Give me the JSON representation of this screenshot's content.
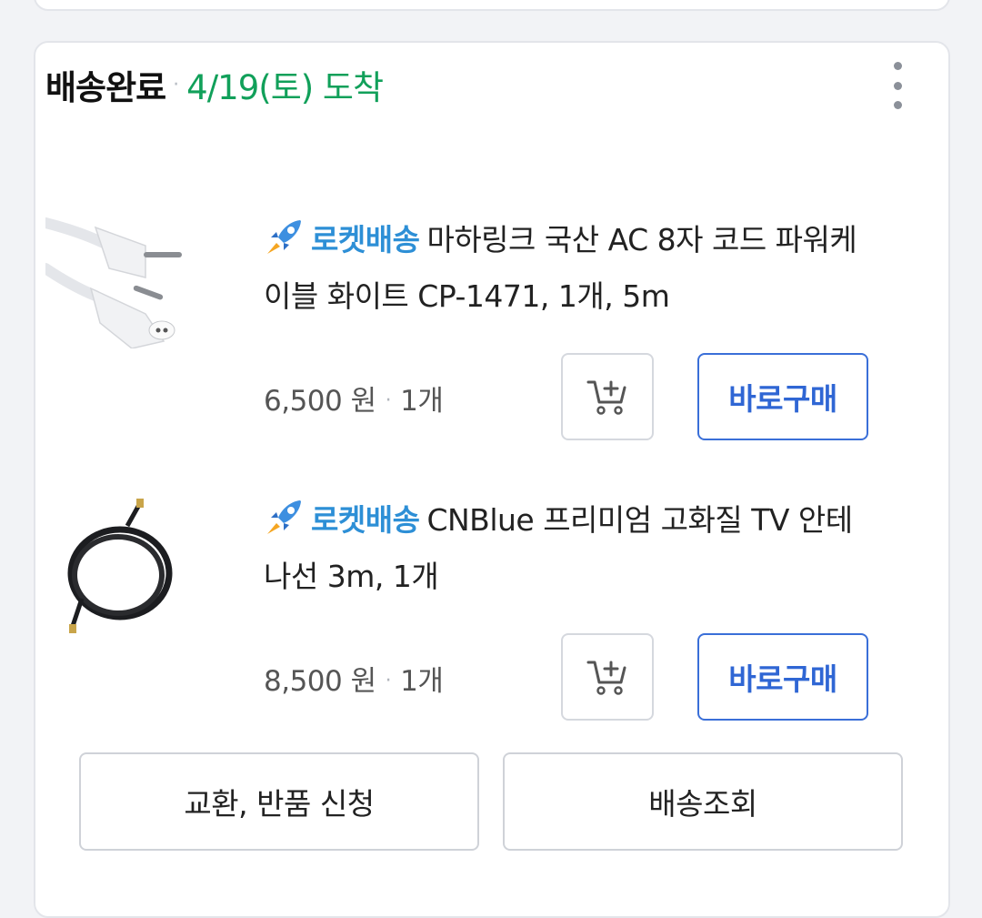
{
  "order": {
    "status": "배송완료",
    "separator": "·",
    "arrival": "4/19(토) 도착"
  },
  "items": [
    {
      "badge": "로켓배송",
      "title": "마하링크 국산 AC 8자 코드 파워케이블 화이트 CP-1471, 1개, 5m",
      "price": "6,500 원",
      "qty": "1개",
      "buy_label": "바로구매",
      "image": "white-power-cable"
    },
    {
      "badge": "로켓배송",
      "title": "CNBlue 프리미엄 고화질 TV 안테나선 3m, 1개",
      "price": "8,500 원",
      "qty": "1개",
      "buy_label": "바로구매",
      "image": "black-antenna-cable"
    }
  ],
  "actions": {
    "exchange_return": "교환, 반품 신청",
    "track": "배송조회"
  },
  "colors": {
    "arrival": "#11a05a",
    "rocket_badge": "#2d8fd6",
    "buy_button": "#2f66d4"
  },
  "icons": [
    "more-vertical-icon",
    "rocket-icon",
    "cart-add-icon"
  ]
}
